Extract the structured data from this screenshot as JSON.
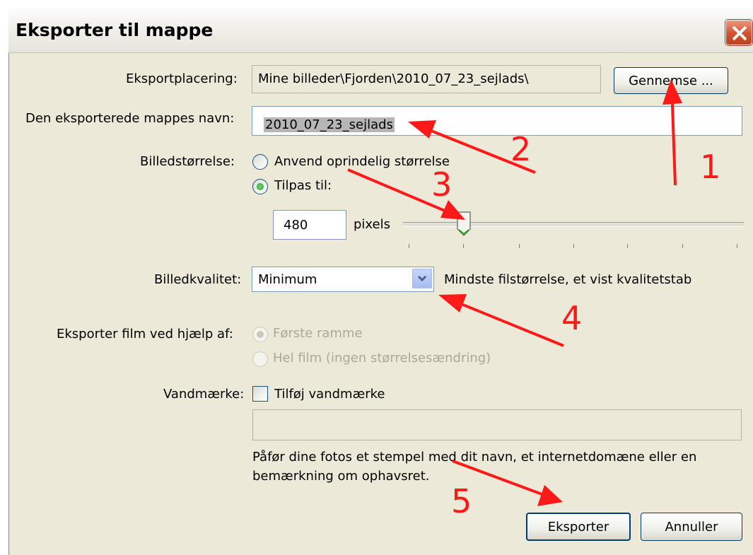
{
  "window": {
    "title": "Eksporter til mappe"
  },
  "location": {
    "label": "Eksportplacering:",
    "value": "Mine billeder\\Fjorden\\2010_07_23_sejlads\\",
    "browse_label": "Gennemse ..."
  },
  "folder_name": {
    "label": "Den eksporterede mappes navn:",
    "value": "2010_07_23_sejlads"
  },
  "image_size": {
    "label": "Billedstørrelse:",
    "option_original": "Anvend oprindelig størrelse",
    "option_fit": "Tilpas til:",
    "selected": "Tilpas til:",
    "pixels_value": "480",
    "pixels_label": "pixels",
    "slider_fraction": 0.18
  },
  "quality": {
    "label": "Billedkvalitet:",
    "value": "Minimum",
    "description": "Mindste filstørrelse, et vist kvalitetstab"
  },
  "movie": {
    "label": "Eksporter film ved hjælp af:",
    "option_first_frame": "Første ramme",
    "option_whole": "Hel film (ingen størrelsesændring)"
  },
  "watermark": {
    "label": "Vandmærke:",
    "checkbox_label": "Tilføj vandmærke",
    "checked": false,
    "text_value": "",
    "help_line1": "Påfør dine fotos et stempel med dit navn, et internetdomæne eller en",
    "help_line2": "bemærkning om ophavsret."
  },
  "buttons": {
    "export": "Eksporter",
    "cancel": "Annuller"
  },
  "annotations": [
    "1",
    "2",
    "3",
    "4",
    "5"
  ],
  "colors": {
    "annotation": "#ff1a1a",
    "dialog_bg": "#ece9d8",
    "radio_dot": "#21a121"
  }
}
